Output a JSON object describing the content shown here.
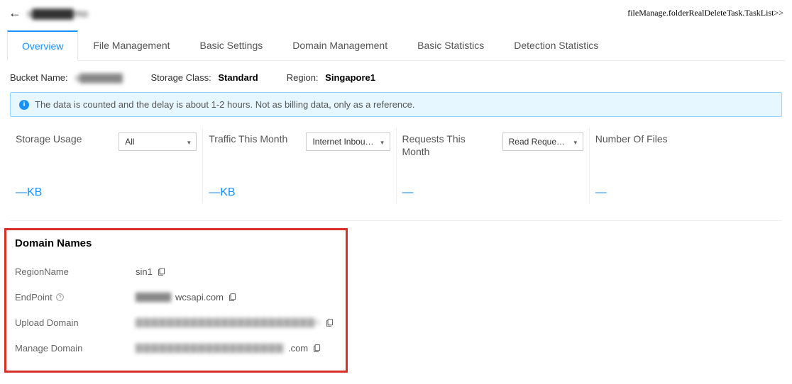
{
  "header": {
    "title_masked": "s▇▇▇▇▇mo",
    "task_link": "fileManage.folderRealDeleteTask.TaskList>>"
  },
  "tabs": [
    {
      "label": "Overview"
    },
    {
      "label": "File Management"
    },
    {
      "label": "Basic Settings"
    },
    {
      "label": "Domain Management"
    },
    {
      "label": "Basic Statistics"
    },
    {
      "label": "Detection Statistics"
    }
  ],
  "info": {
    "bucket_name_label": "Bucket Name:",
    "bucket_name_value": "s▇▇▇▇▇▇",
    "storage_class_label": "Storage Class:",
    "storage_class_value": "Standard",
    "region_label": "Region:",
    "region_value": "Singapore1"
  },
  "alert": {
    "text": "The data is counted and the delay is about 1-2 hours. Not as billing data, only as a reference."
  },
  "stats": {
    "storage": {
      "title": "Storage Usage",
      "select": "All",
      "value": "—KB"
    },
    "traffic": {
      "title": "Traffic This Month",
      "select": "Internet Inbou…",
      "value": "—KB"
    },
    "requests": {
      "title": "Requests This Month",
      "select": "Read Requests",
      "value": "—"
    },
    "files": {
      "title": "Number Of Files",
      "value": "—"
    }
  },
  "domains": {
    "section_title": "Domain Names",
    "region_name_label": "RegionName",
    "region_name_value": "sin1",
    "endpoint_label": "EndPoint",
    "endpoint_prefix": "▇▇▇▇▇",
    "endpoint_suffix": "wcsapi.com",
    "upload_label": "Upload Domain",
    "upload_value": "▇▇▇▇▇▇▇▇▇▇▇▇▇▇▇▇▇▇▇▇▇▇▇n",
    "manage_label": "Manage Domain",
    "manage_prefix": "▇▇▇▇▇▇▇▇▇▇▇▇▇▇▇▇▇▇▇",
    "manage_suffix": ".com"
  }
}
